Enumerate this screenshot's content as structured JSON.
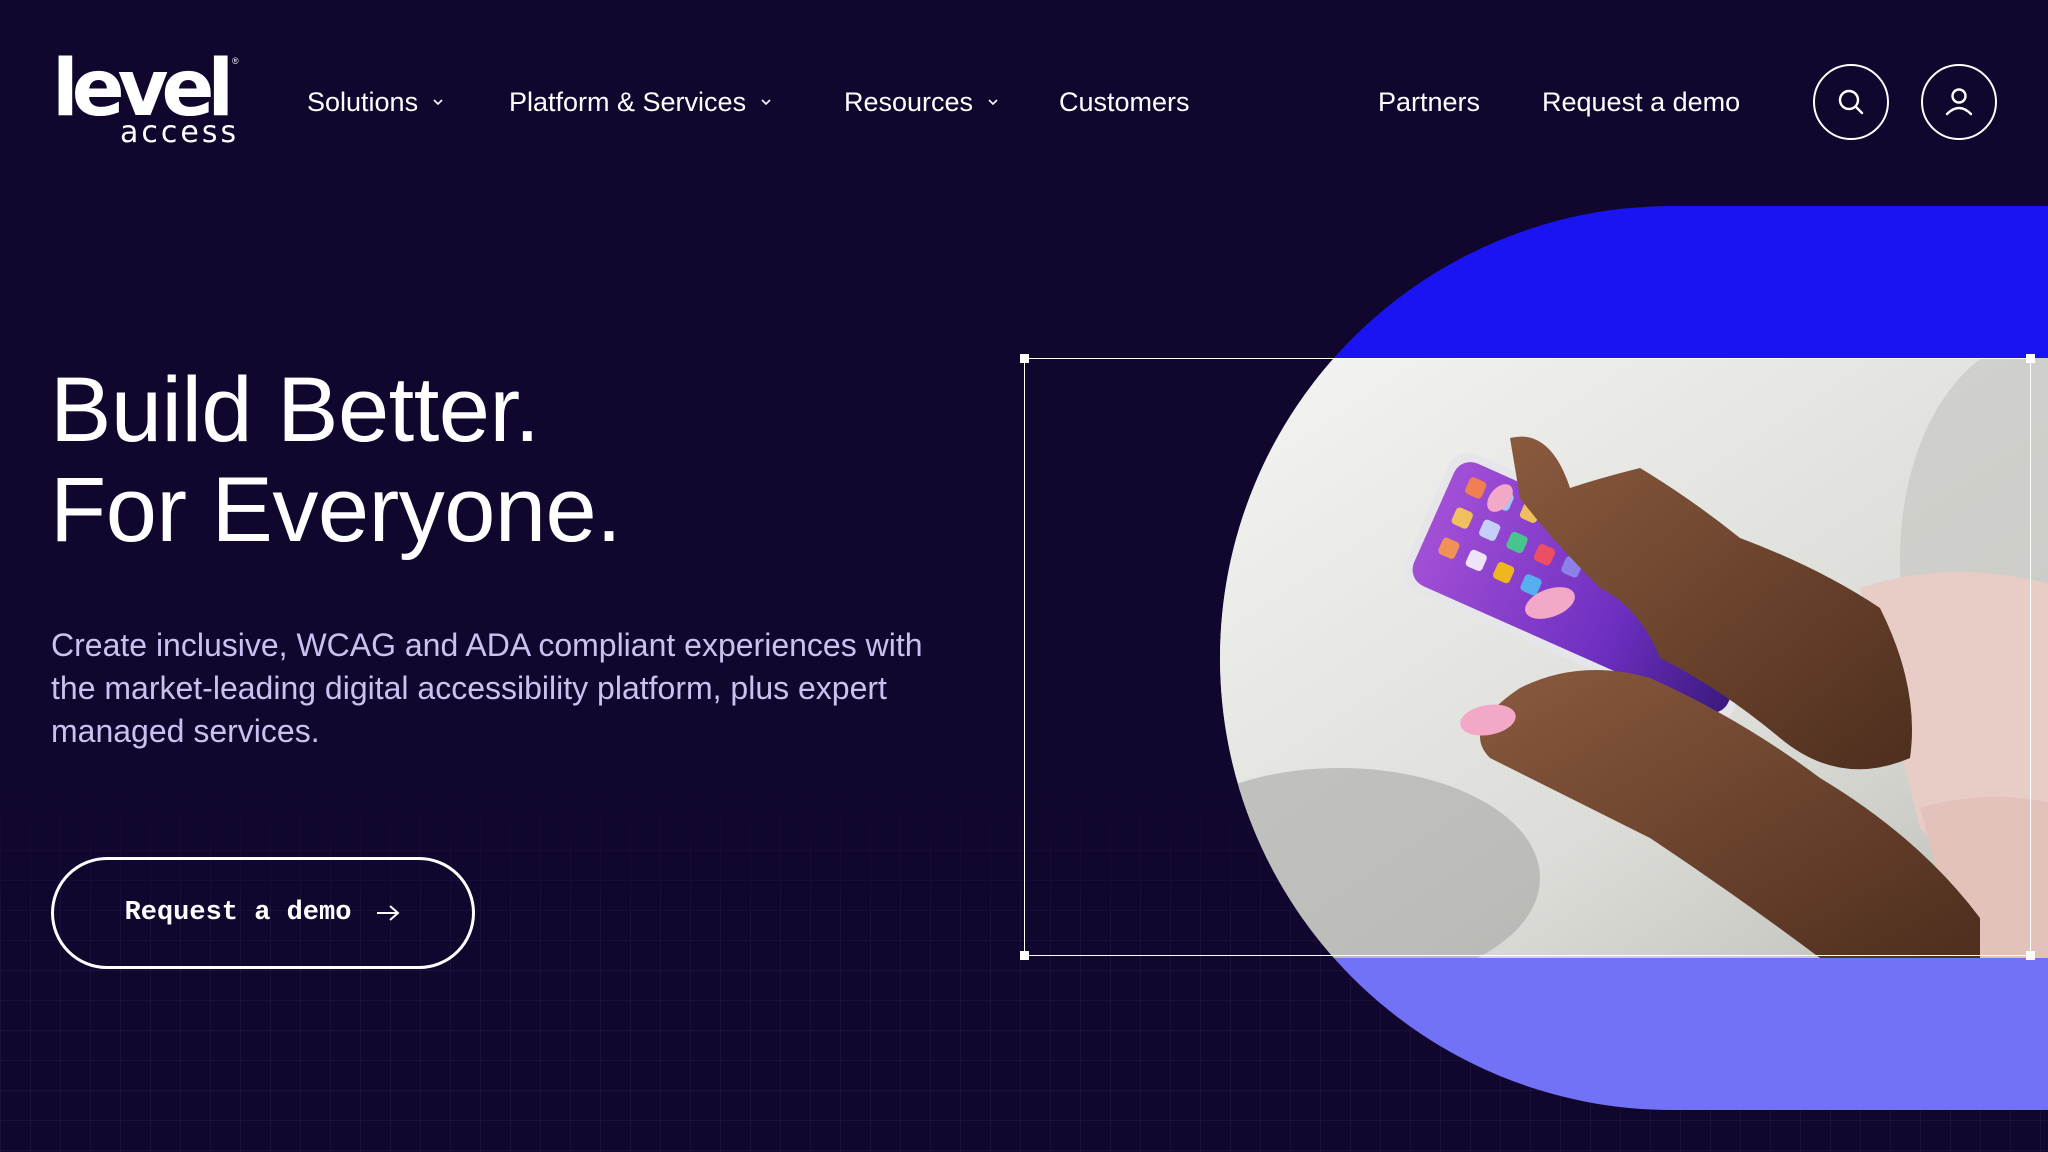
{
  "brand": {
    "logo_main": "level",
    "logo_sub": "access",
    "logo_reg": "®"
  },
  "nav": {
    "items": [
      {
        "label": "Solutions",
        "has_dropdown": true
      },
      {
        "label": "Platform & Services",
        "has_dropdown": true
      },
      {
        "label": "Resources",
        "has_dropdown": true
      },
      {
        "label": "Customers",
        "has_dropdown": false
      }
    ],
    "partners": "Partners",
    "request_demo": "Request a demo",
    "search_icon": "search-icon",
    "account_icon": "user-account-icon"
  },
  "hero": {
    "title_line1": "Build Better.",
    "title_line2": "For Everyone.",
    "description": "Create inclusive, WCAG and ADA compliant experiences with the market-leading digital accessibility platform, plus expert managed services.",
    "cta_label": "Request a demo",
    "cta_icon": "arrow-right-icon"
  },
  "visual": {
    "image": "hands-holding-smartphone",
    "colors": {
      "background": "#11062e",
      "blue_top": "#1b14f2",
      "blue_bottom": "#7272f7",
      "body_text": "#c9c2f0"
    }
  }
}
